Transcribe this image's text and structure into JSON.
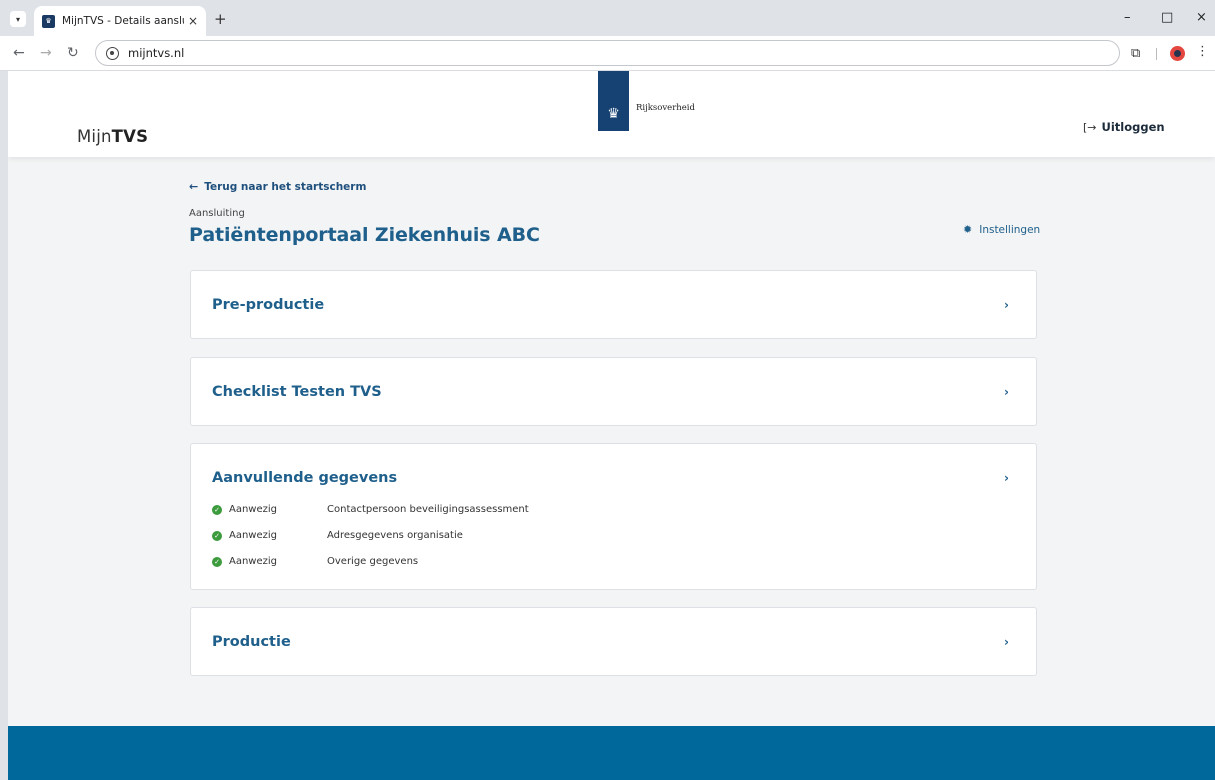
{
  "browser": {
    "tab_title": "MijnTVS - Details aansluiting",
    "tab_close": "×",
    "new_tab": "+",
    "url": "mijntvs.nl",
    "controls": {
      "minimize": "–",
      "maximize": "□",
      "close": "×"
    }
  },
  "header": {
    "brand_prefix": "Mijn",
    "brand_suffix": "TVS",
    "logo_text": "Rijksoverheid",
    "logout_label": "Uitloggen"
  },
  "page": {
    "back_link": "Terug naar het startscherm",
    "eyebrow": "Aansluiting",
    "title": "Patiëntenportaal Ziekenhuis ABC",
    "settings_label": "Instellingen"
  },
  "cards": [
    {
      "title": "Pre-productie"
    },
    {
      "title": "Checklist Testen TVS"
    },
    {
      "title": "Aanvullende gegevens",
      "items": [
        {
          "status": "Aanwezig",
          "label": "Contactpersoon beveiligingsassessment"
        },
        {
          "status": "Aanwezig",
          "label": "Adresgegevens organisatie"
        },
        {
          "status": "Aanwezig",
          "label": "Overige gegevens"
        }
      ]
    },
    {
      "title": "Productie"
    }
  ],
  "colors": {
    "primary": "#1f5f8b",
    "logo_blue": "#154273",
    "footer": "#01689b",
    "success": "#3c9b3c"
  },
  "icons": {
    "back": "arrow-left-icon",
    "settings": "gear-icon",
    "logout": "logout-icon",
    "chevron": "chevron-right-icon",
    "status": "check-circle-icon"
  }
}
